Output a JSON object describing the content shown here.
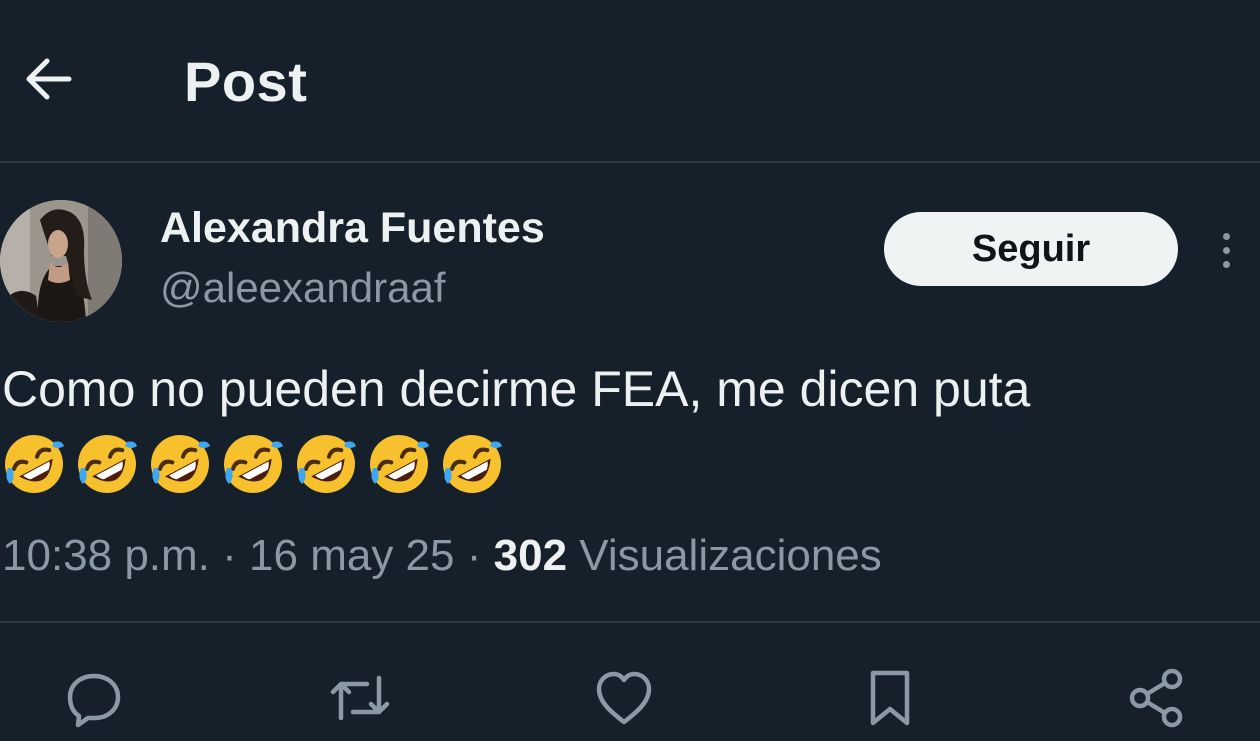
{
  "header": {
    "back_icon": "arrow-left-icon",
    "title": "Post"
  },
  "author": {
    "name": "Alexandra Fuentes",
    "handle": "@aleexandraaf",
    "follow_label": "Seguir",
    "more_icon": "more-vertical-icon"
  },
  "post": {
    "text": "Como no pueden decirme FEA, me dicen puta",
    "emoji_name": "rolling-on-the-floor-laughing",
    "emoji_count": 7
  },
  "meta": {
    "time": "10:38 p.m.",
    "separator": "·",
    "date": "16 may 25",
    "views_count": "302",
    "views_label": "Visualizaciones"
  },
  "actions": [
    {
      "icon": "reply-icon"
    },
    {
      "icon": "repost-icon"
    },
    {
      "icon": "like-icon"
    },
    {
      "icon": "bookmark-icon"
    },
    {
      "icon": "share-icon"
    }
  ],
  "colors": {
    "background": "#16202b",
    "text_primary": "#eef1f2",
    "text_secondary": "#8b98a5",
    "divider": "#2c3945",
    "follow_bg": "#eff3f4"
  }
}
